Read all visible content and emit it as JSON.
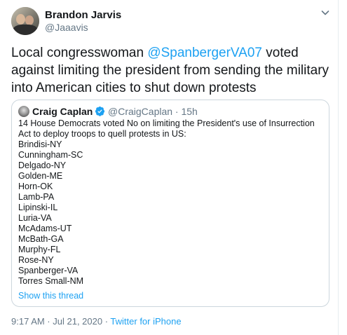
{
  "tweet": {
    "author_name": "Brandon Jarvis",
    "author_handle": "@Jaaavis",
    "text_before": "Local congresswoman ",
    "mention": "@SpanbergerVA07",
    "text_after": " voted against limiting the president from sending the military into American cities to shut down protests",
    "timestamp": "9:17 AM · Jul 21, 2020",
    "separator": " · ",
    "source": "Twitter for iPhone",
    "caret_icon": "chevron-down-icon"
  },
  "quote": {
    "author_name": "Craig Caplan",
    "verified_icon": "verified-badge-icon",
    "handle_time": "@CraigCaplan · 15h",
    "intro": "14 House Democrats voted No on limiting the President's use of Insurrection Act to deploy troops to quell protests in US:",
    "members": [
      "Brindisi-NY",
      "Cunningham-SC",
      "Delgado-NY",
      "Golden-ME",
      "Horn-OK",
      "Lamb-PA",
      "Lipinski-IL",
      "Luria-VA",
      "McAdams-UT",
      "McBath-GA",
      "Murphy-FL",
      "Rose-NY",
      "Spanberger-VA",
      "Torres Small-NM"
    ],
    "show_thread": "Show this thread"
  },
  "colors": {
    "accent": "#1da1f2",
    "secondary_text": "#657786",
    "border": "#ccd6dd"
  }
}
